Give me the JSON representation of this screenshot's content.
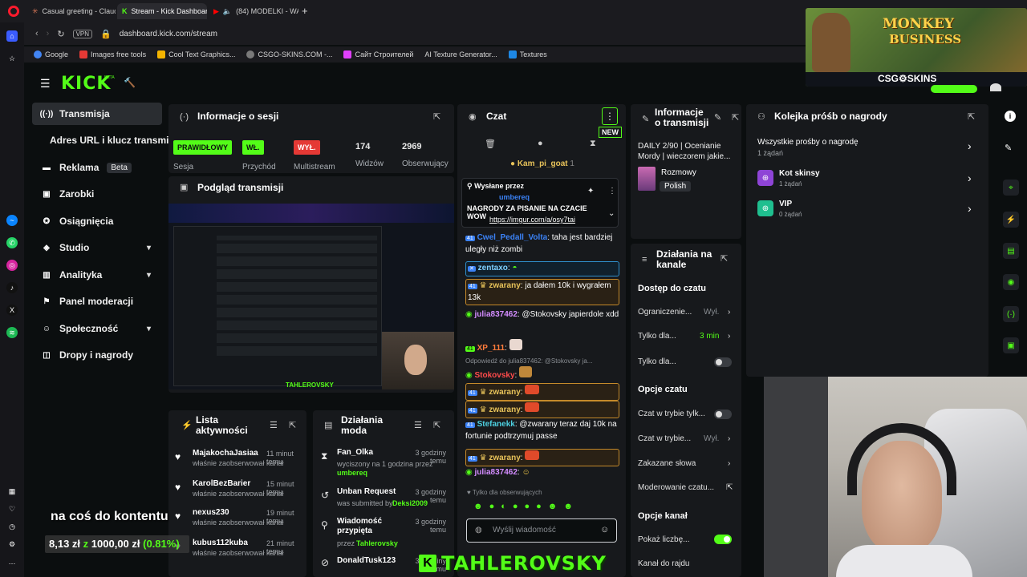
{
  "browser": {
    "tabs": [
      {
        "label": "Casual greeting - Claude"
      },
      {
        "label": "Stream - Kick Dashboard"
      },
      {
        "label": "(84) MODELKI - WAYU"
      }
    ],
    "vpn": "VPN",
    "url": "dashboard.kick.com/stream",
    "bookmarks": [
      "Google",
      "Images free tools",
      "Cool Text Graphics...",
      "CSGO-SKINS.COM -...",
      "Сайт Строителей",
      "AI Texture Generator...",
      "Textures"
    ]
  },
  "brand": {
    "logo": "KICK",
    "logo_sup": "BETA"
  },
  "ad": {
    "title_line1": "MONKEY",
    "title_line2": "BUSINESS",
    "sponsor": "CSG⚙SKINS"
  },
  "nav": {
    "items": [
      {
        "label": "Transmisja"
      },
      {
        "label": "Adres URL i klucz transmisji"
      },
      {
        "label": "Reklama",
        "badge": "Beta"
      },
      {
        "label": "Zarobki"
      },
      {
        "label": "Osiągnięcia"
      },
      {
        "label": "Studio"
      },
      {
        "label": "Analityka"
      },
      {
        "label": "Panel moderacji"
      },
      {
        "label": "Społeczność"
      },
      {
        "label": "Dropy i nagrody"
      }
    ]
  },
  "session": {
    "title": "Informacje o sesji",
    "stats": [
      {
        "badge": "PRAWIDŁOWY",
        "label": "Sesja"
      },
      {
        "badge": "WŁ.",
        "label": "Przychód"
      },
      {
        "badge": "WYŁ.",
        "label": "Multistream"
      },
      {
        "value": "174",
        "label": "Widzów"
      },
      {
        "value": "2969",
        "label": "Obserwujący"
      }
    ]
  },
  "preview": {
    "title": "Podgląd transmisji",
    "overlay": "TAHLEROVSKY"
  },
  "activity": {
    "title_line1": "Lista",
    "title_line2": "aktywności",
    "items": [
      {
        "name": "MajakochaJasiaa",
        "time": "11 minut temu",
        "sub": "właśnie zaobserwował kanał"
      },
      {
        "name": "KarolBezBarier",
        "time": "15 minut temu",
        "sub": "właśnie zaobserwował kanał"
      },
      {
        "name": "nexus230",
        "time": "19 minut temu",
        "sub": "właśnie zaobserwował kanał"
      },
      {
        "name": "kubus112kuba",
        "time": "21 minut temu",
        "sub": "właśnie zaobserwował kanał"
      }
    ]
  },
  "modactions": {
    "title_line1": "Działania",
    "title_line2": "moda",
    "items": [
      {
        "name": "Fan_Olka",
        "time": "3 godziny temu",
        "sub": "wyciszony na 1 godzina przez",
        "by": "umbereq"
      },
      {
        "name": "Unban Request",
        "time": "3 godziny temu",
        "sub": "was submitted by",
        "by": "Deksi2009"
      },
      {
        "name": "Wiadomość przypięta",
        "time": "3 godziny temu",
        "sub": "przez",
        "by": "Tahlerovsky"
      },
      {
        "name": "DonaldTusk123",
        "time": "3 godziny temu",
        "sub": "",
        "by": ""
      }
    ]
  },
  "chat": {
    "title": "Czat",
    "new_badge": "NEW",
    "top_user": "Kam_pi_goat",
    "top_count": "1",
    "pinned_label": "Wysłane przez",
    "pinned_user": "umbereq",
    "pinned_text": "NAGRODY ZA PISANIE NA CZACIE WOW",
    "pinned_link": "https://imgur.com/a/osy7tai",
    "messages": [
      {
        "user": "Cwel_Pedall_Volta",
        "text": "taha jest bardziej uległy niż zombi"
      },
      {
        "user": "zentaxo",
        "text": ""
      },
      {
        "user": "zwarany",
        "text": "ja dałem 10k i wygrałem 13k"
      },
      {
        "user": "julia837462",
        "text": "@Stokovsky japierdole xdd"
      },
      {
        "user": "XP_111",
        "text": ""
      },
      {
        "user": "Stokovsky",
        "text": "",
        "reply": "Odpowiedź do julia837462: @Stokovsky ja..."
      },
      {
        "user": "zwarany",
        "text": ""
      },
      {
        "user": "zwarany",
        "text": ""
      },
      {
        "user": "Stefanekk",
        "text": "@zwarany teraz daj 10k na fortunie podtrzymuj passe"
      },
      {
        "user": "zwarany",
        "text": ""
      },
      {
        "user": "julia837462",
        "text": ""
      }
    ],
    "followers_only": "Tylko dla obserwujących",
    "input_placeholder": "Wyślij wiadomość"
  },
  "streaminfo": {
    "title_line1": "Informacje",
    "title_line2": "o transmisji",
    "stream_title": "DAILY 2/90 | Ocenianie Mordy | wieczorem jakie...",
    "category": "Rozmowy",
    "language": "Polish"
  },
  "channelactions": {
    "title_line1": "Działania na",
    "title_line2": "kanale",
    "chat_access": "Dostęp do czatu",
    "rows_access": [
      {
        "label": "Ograniczenie...",
        "value": "Wył."
      },
      {
        "label": "Tylko dla...",
        "value": "3 min"
      },
      {
        "label": "Tylko dla...",
        "value": ""
      }
    ],
    "chat_options": "Opcje czatu",
    "rows_options": [
      {
        "label": "Czat w trybie tylk...",
        "value": ""
      },
      {
        "label": "Czat w trybie...",
        "value": "Wył."
      },
      {
        "label": "Zakazane słowa",
        "value": ""
      },
      {
        "label": "Moderowanie czatu...",
        "value": ""
      }
    ],
    "channel_options": "Opcje kanał",
    "rows_channel": [
      {
        "label": "Pokaż liczbę..."
      },
      {
        "label": "Kanał do rajdu"
      }
    ]
  },
  "rewards": {
    "title": "Kolejka próśb o nagrody",
    "all_label": "Wszystkie prośby o nagrodę",
    "all_count": "1 żądań",
    "items": [
      {
        "name": "Kot skinsy",
        "count": "1 żądań"
      },
      {
        "name": "VIP",
        "count": "0 żądań"
      }
    ]
  },
  "overlay": {
    "goal_text": "na coś do kontentu",
    "amount": "8,13 zł",
    "z": "z",
    "target": "1000,00 zł",
    "percent": "(0.81%)"
  },
  "colors": {
    "accent": "#53fc18",
    "panel": "#17191c",
    "bg": "#0b0e0f",
    "highlight": "#c58a2a"
  }
}
